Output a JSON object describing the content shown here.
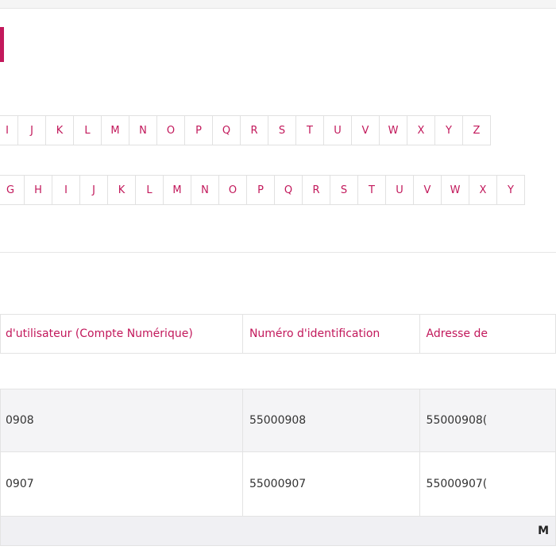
{
  "alphabet_row_1": [
    "I",
    "J",
    "K",
    "L",
    "M",
    "N",
    "O",
    "P",
    "Q",
    "R",
    "S",
    "T",
    "U",
    "V",
    "W",
    "X",
    "Y",
    "Z"
  ],
  "alphabet_row_2": [
    "G",
    "H",
    "I",
    "J",
    "K",
    "L",
    "M",
    "N",
    "O",
    "P",
    "Q",
    "R",
    "S",
    "T",
    "U",
    "V",
    "W",
    "X",
    "Y"
  ],
  "table": {
    "headers": [
      "d'utilisateur (Compte Numérique)",
      "Numéro d'identification",
      "Adresse de"
    ],
    "rows": [
      [
        "0908",
        "55000908",
        "55000908("
      ],
      [
        "0907",
        "55000907",
        "55000907("
      ]
    ],
    "footer": "M"
  },
  "colors": {
    "accent": "#c2185b"
  }
}
